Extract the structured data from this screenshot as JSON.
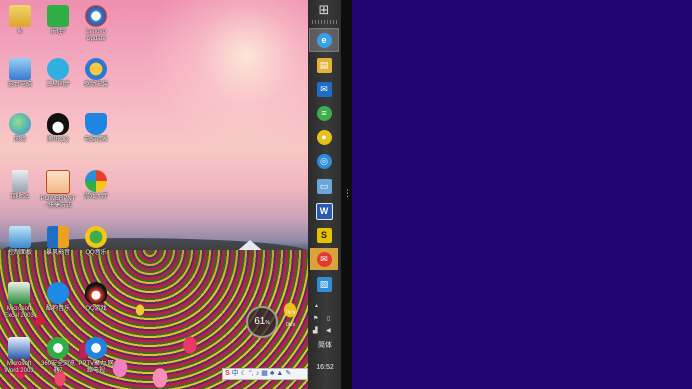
{
  "desktop": {
    "icons": [
      {
        "name": "user-folder",
        "label": "lk"
      },
      {
        "name": "app-green",
        "label": "乐蛙?"
      },
      {
        "name": "lenovo-update",
        "label": "Lenovo\nUpdate"
      },
      {
        "name": "this-pc",
        "label": "这台电脑"
      },
      {
        "name": "sync-app",
        "label": "三星同步"
      },
      {
        "name": "driver-app",
        "label": "驱动安装"
      },
      {
        "name": "network",
        "label": "网络"
      },
      {
        "name": "qq",
        "label": "腾讯QQ"
      },
      {
        "name": "shield-app",
        "label": "电脑管家"
      },
      {
        "name": "recycle-bin",
        "label": "回收站"
      },
      {
        "name": "powerpoint",
        "label": "POWERPNT\n- 快捷方式"
      },
      {
        "name": "games-app",
        "label": "游戏大厅"
      },
      {
        "name": "control-panel",
        "label": "控制面板"
      },
      {
        "name": "storm-player",
        "label": "暴风影音"
      },
      {
        "name": "qq-music",
        "label": "QQ音乐"
      },
      {
        "name": "excel",
        "label": "Microsoft\nExcel 2003"
      },
      {
        "name": "kugou",
        "label": "酷狗音乐"
      },
      {
        "name": "qq-game",
        "label": "QQ游戏"
      },
      {
        "name": "word",
        "label": "Microsoft\nWord 2003"
      },
      {
        "name": "360-browser",
        "label": "360安全浏览\n器7"
      },
      {
        "name": "pptv",
        "label": "PPTV聚力 网\n络电视"
      }
    ],
    "speed_widget": {
      "value": "61",
      "unit": "%",
      "up": "0k/s",
      "down": "0k/s"
    },
    "ime_bar": {
      "logo": "S",
      "mode": "中"
    }
  },
  "taskbar": {
    "start_icon": "windows-icon",
    "pinned": [
      {
        "name": "ie",
        "glyph": "e",
        "color": "#3aa0e8"
      },
      {
        "name": "explorer",
        "glyph": "▤",
        "color": "#e2b43a"
      },
      {
        "name": "mail",
        "glyph": "✉",
        "color": "#1e6ec8"
      },
      {
        "name": "360-safe",
        "glyph": "≡",
        "color": "#3bb04a"
      },
      {
        "name": "qq-browser",
        "glyph": "●",
        "color": "#e6c21e"
      },
      {
        "name": "browser-blue",
        "glyph": "◎",
        "color": "#2e8fd8"
      },
      {
        "name": "this-pc",
        "glyph": "▭",
        "color": "#6aa6d8"
      },
      {
        "name": "word",
        "glyph": "W",
        "color": "#2a5ab0"
      },
      {
        "name": "sogou",
        "glyph": "S",
        "color": "#e6c200"
      },
      {
        "name": "mail-red",
        "glyph": "✉",
        "color": "#e03a2a"
      },
      {
        "name": "photos",
        "glyph": "▧",
        "color": "#2e8fd8"
      }
    ],
    "ime_mode": "简体",
    "clock": "16:52"
  },
  "colors": {
    "metro_background": "#20066e",
    "taskbar": "#333333",
    "accent_hot": "#d9a23c"
  }
}
